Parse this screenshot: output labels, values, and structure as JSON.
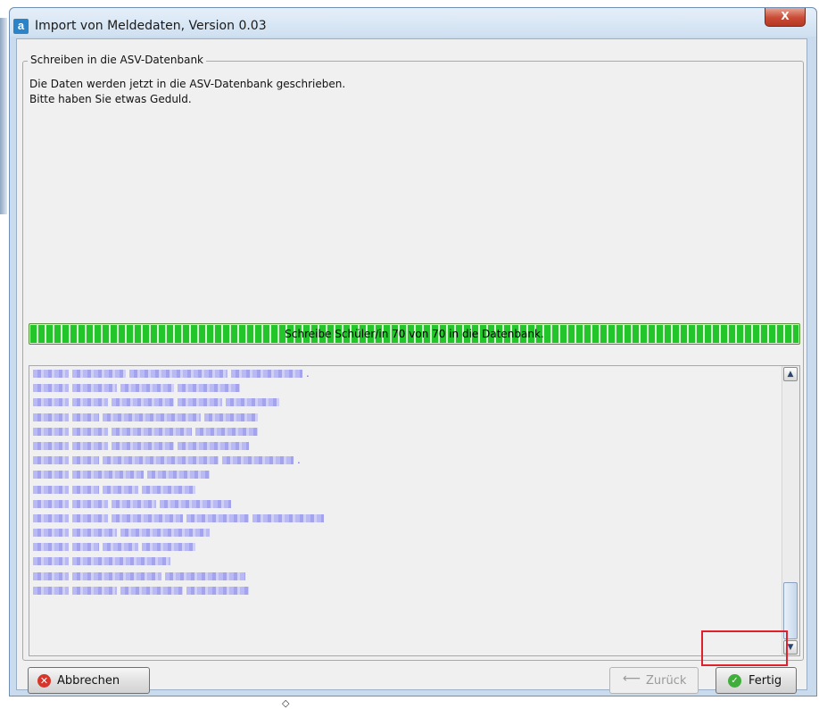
{
  "window": {
    "title": "Import von Meldedaten, Version 0.03",
    "app_icon": "a",
    "close_symbol": "X"
  },
  "group": {
    "title": "Schreiben in die ASV-Datenbank",
    "message_lines": [
      "Die Daten werden jetzt in die ASV-Datenbank geschrieben.",
      "Bitte haben Sie etwas Geduld."
    ]
  },
  "progress": {
    "text": "Schreibe Schüler/in 70 von 70 in die Datenbank.",
    "current": 70,
    "total": 70,
    "fraction": 1.0,
    "color": "#22c52a"
  },
  "log": {
    "note": "",
    "lines": [
      {
        "widths": [
          40,
          60,
          110,
          80
        ],
        "suffix": "."
      },
      {
        "widths": [
          40,
          50,
          60,
          70
        ],
        "suffix": ""
      },
      {
        "widths": [
          40,
          40,
          70,
          50,
          60
        ],
        "suffix": ""
      },
      {
        "widths": [
          40,
          30,
          110,
          60
        ],
        "suffix": ""
      },
      {
        "widths": [
          40,
          40,
          90,
          70
        ],
        "suffix": ""
      },
      {
        "widths": [
          40,
          40,
          70,
          80
        ],
        "suffix": ""
      },
      {
        "widths": [
          40,
          30,
          130,
          80
        ],
        "suffix": "."
      },
      {
        "widths": [
          40,
          80,
          70
        ],
        "suffix": ""
      },
      {
        "widths": [
          40,
          30,
          40,
          60
        ],
        "suffix": ""
      },
      {
        "widths": [
          40,
          40,
          50,
          80
        ],
        "suffix": ""
      },
      {
        "widths": [
          40,
          40,
          80,
          70,
          80
        ],
        "suffix": ""
      },
      {
        "widths": [
          40,
          50,
          100
        ],
        "suffix": ""
      },
      {
        "widths": [
          40,
          30,
          40,
          60
        ],
        "suffix": ""
      },
      {
        "widths": [
          40,
          110
        ],
        "suffix": ""
      },
      {
        "widths": [
          40,
          100,
          90
        ],
        "suffix": ""
      },
      {
        "widths": [
          40,
          50,
          70,
          70
        ],
        "suffix": ""
      }
    ]
  },
  "buttons": {
    "cancel": "Abbrechen",
    "back": "Zurück",
    "finish": "Fertig"
  },
  "colors": {
    "highlight": "#e0202a",
    "redaction": "#b9b9f4"
  }
}
